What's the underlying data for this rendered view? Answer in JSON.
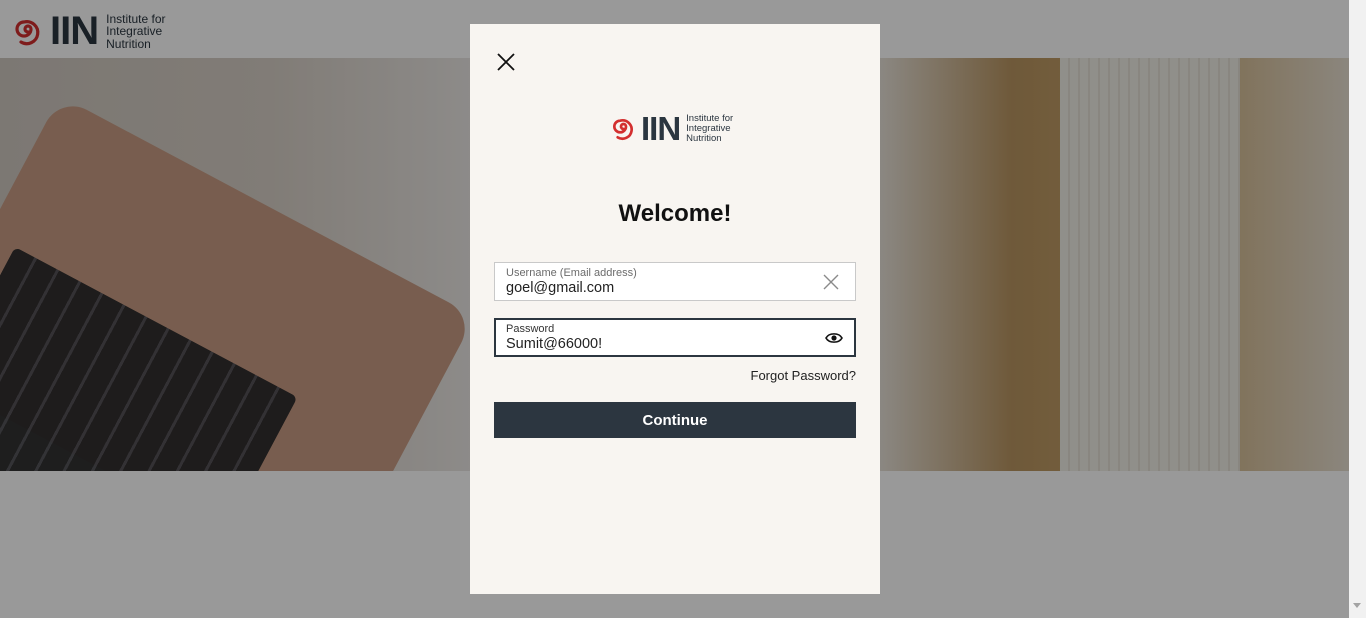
{
  "brand": {
    "wordmark": "IIN",
    "tagline_lines": [
      "Institute for",
      "Integrative",
      "Nutrition"
    ]
  },
  "modal": {
    "heading": "Welcome!",
    "username": {
      "label": "Username (Email address)",
      "value": "goel@gmail.com"
    },
    "password": {
      "label": "Password",
      "value": "Sumit@66000!"
    },
    "forgot_link": "Forgot Password?",
    "continue_label": "Continue"
  },
  "colors": {
    "brand_red": "#d32f2f",
    "brand_dark": "#2b3640",
    "modal_bg": "#f8f5f1",
    "button_bg": "#2c3640"
  },
  "icons": [
    "close-icon",
    "clear-icon",
    "eye-icon",
    "spiral-logo-icon",
    "scroll-down-icon"
  ]
}
